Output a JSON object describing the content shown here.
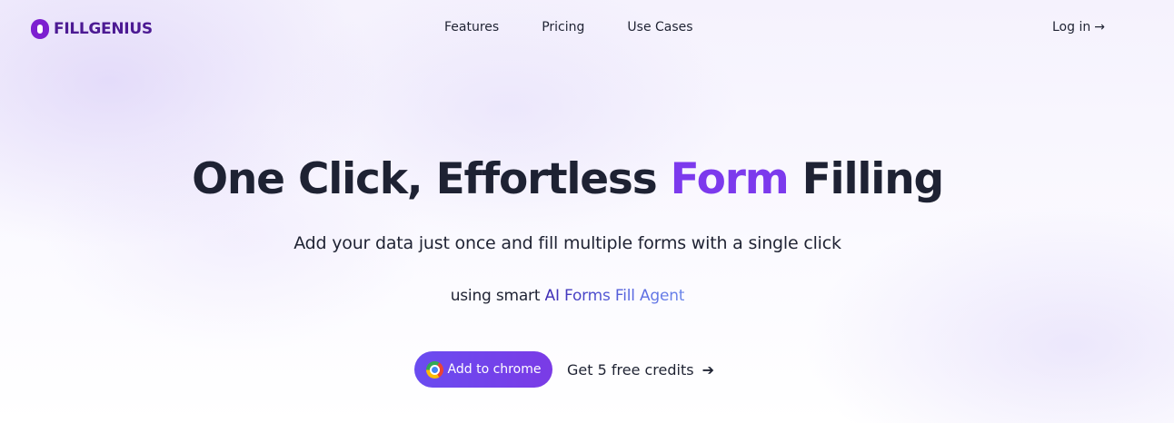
{
  "brand": {
    "name": "FILLGENIUS",
    "primary_color": "#7c3aed",
    "logo_color": "#4c1a93"
  },
  "nav": {
    "items": [
      {
        "label": "Features"
      },
      {
        "label": "Pricing"
      },
      {
        "label": "Use Cases"
      }
    ],
    "login_label": "Log in",
    "login_icon": "arrow-right-icon"
  },
  "hero": {
    "title_part1": "One Click, Effortless ",
    "title_accent": "Form",
    "title_part2": " Filling",
    "subtitle": "Add your data just once and fill multiple forms with a single click",
    "subtitle2_prefix": "using smart ",
    "subtitle2_highlight": "AI Forms Fill Agent"
  },
  "cta": {
    "add_to_chrome_label": "Add to chrome",
    "add_to_chrome_icon": "chrome-icon",
    "free_credits_label": "Get 5 free credits",
    "free_credits_icon": "arrow-right-icon"
  }
}
